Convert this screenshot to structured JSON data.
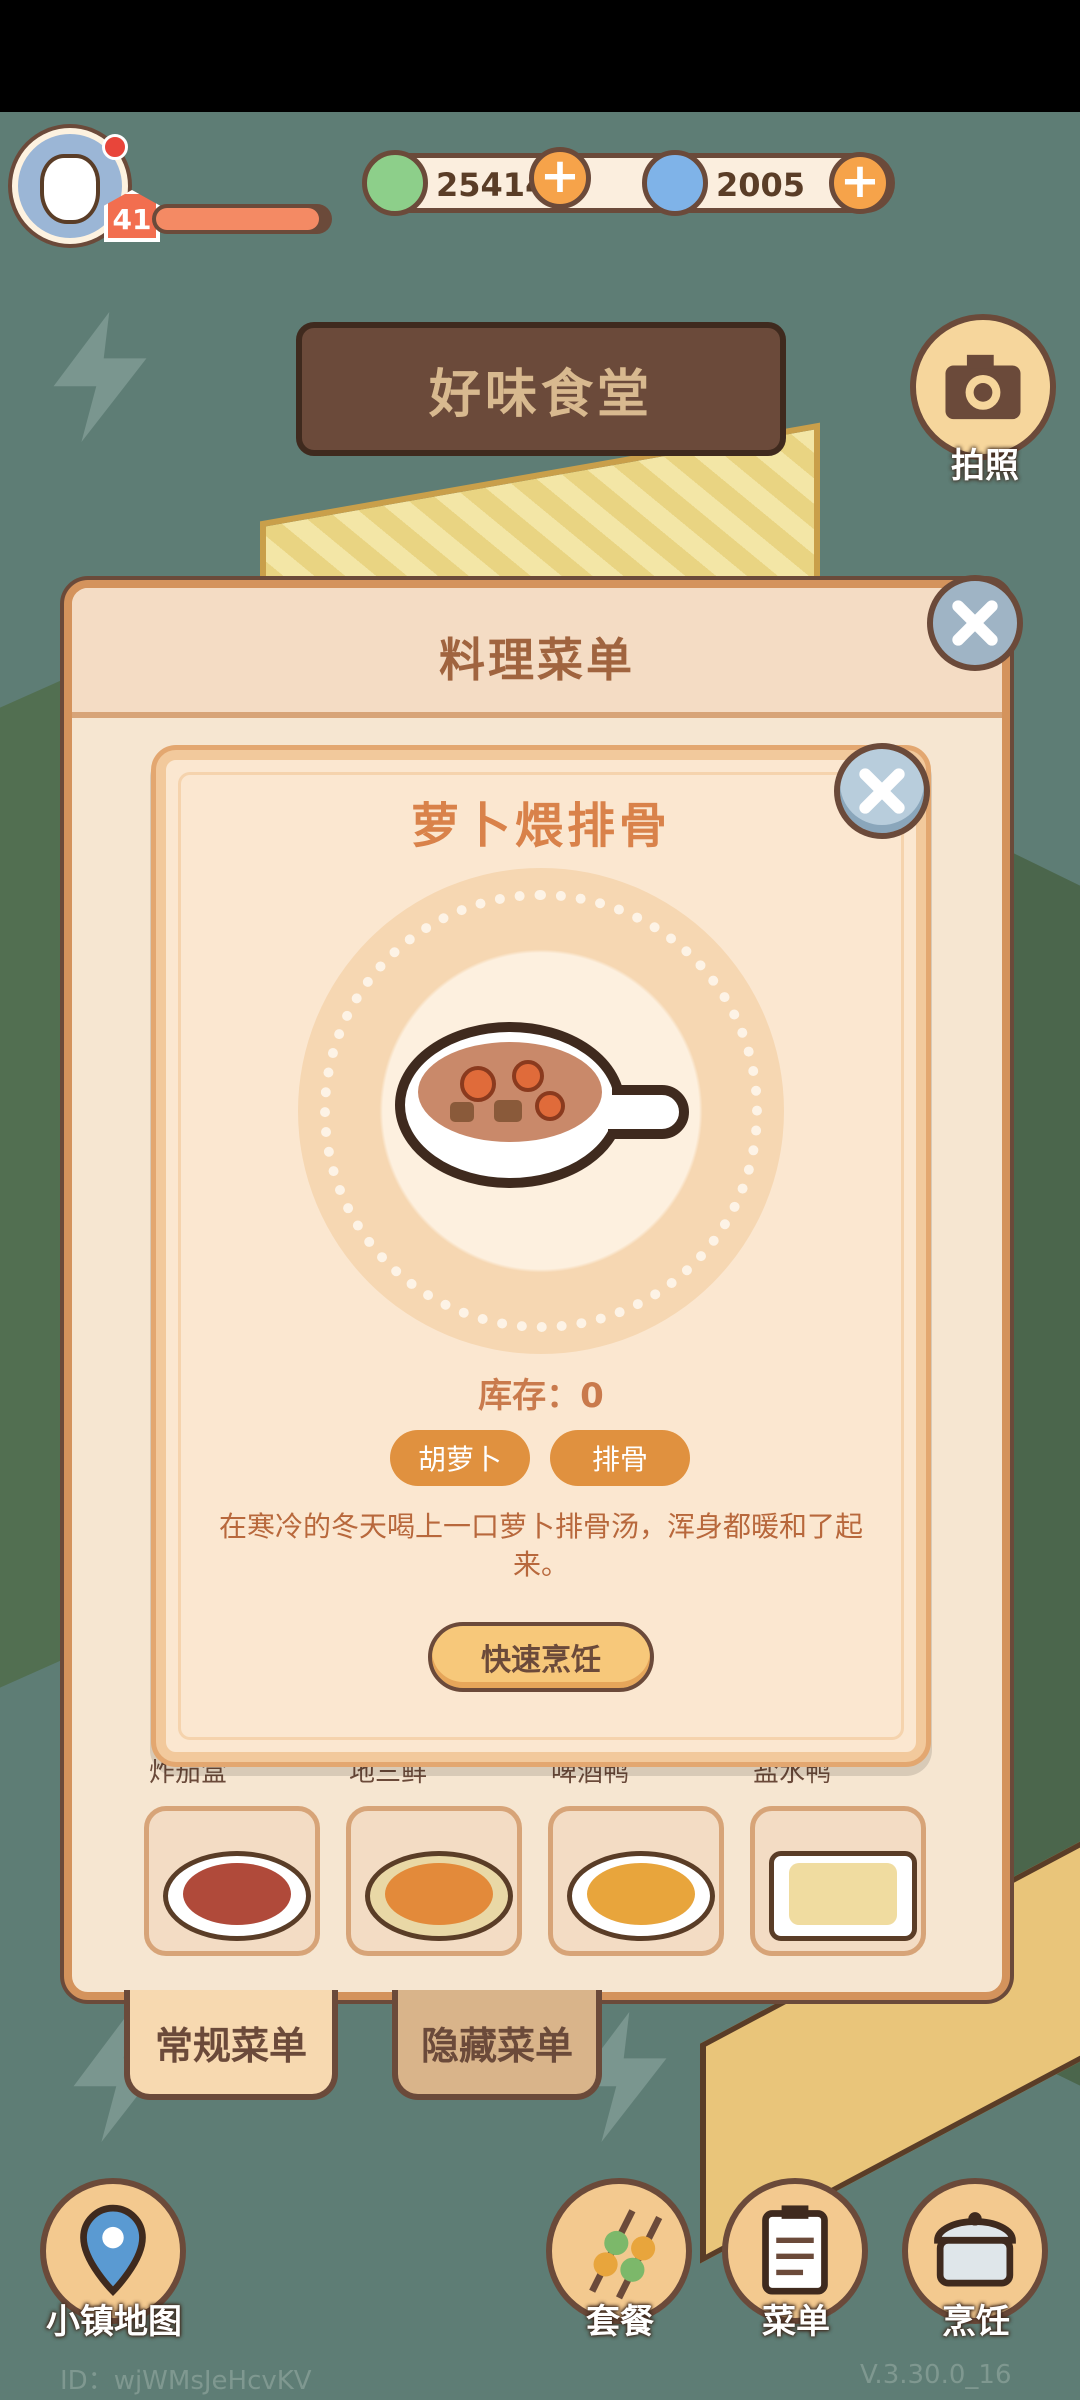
{
  "player": {
    "level": "41",
    "xp_fraction": 0.95
  },
  "currencies": [
    {
      "name": "clover",
      "value": "25414",
      "add_label": "+"
    },
    {
      "name": "swirl",
      "value": "2005",
      "add_label": "+"
    }
  ],
  "restaurant": {
    "title": "好味食堂"
  },
  "camera": {
    "label": "拍照"
  },
  "menu": {
    "title": "料理菜单",
    "dishes": [
      "炸茄盒",
      "地三鲜",
      "啤酒鸭",
      "盐水鸭"
    ],
    "tabs": [
      "常规菜单",
      "隐藏菜单"
    ]
  },
  "dish_detail": {
    "name": "萝卜煨排骨",
    "stock": "库存：0",
    "ingredients": [
      "胡萝卜",
      "排骨"
    ],
    "description": "在寒冷的冬天喝上一口萝卜排骨汤，浑身都暖和了起来。",
    "cook_button": "快速烹饪"
  },
  "bottom_nav": {
    "map": "小镇地图",
    "set_meal": "套餐",
    "menu": "菜单",
    "cook": "烹饪"
  },
  "footer": {
    "id": "ID：wjWMsJeHcvKV",
    "version": "V.3.30.0_16"
  },
  "colors": {
    "accent_orange": "#e0913f",
    "panel_bg": "#f6e6d1",
    "title_brown": "#6b4a3a",
    "dish_title": "#d9824a"
  }
}
